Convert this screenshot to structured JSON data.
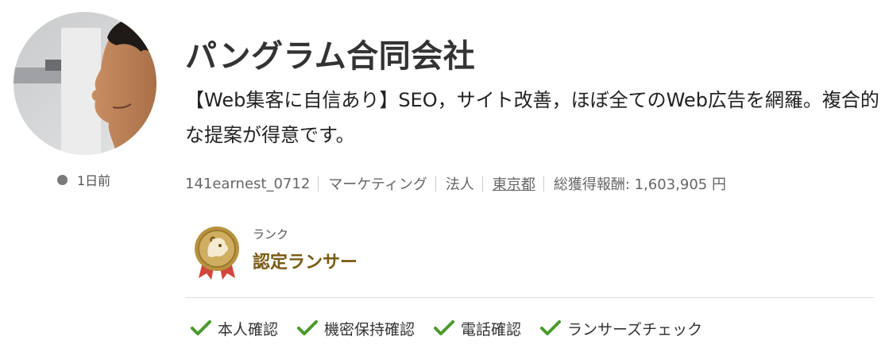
{
  "profile": {
    "name": "パングラム合同会社",
    "catchphrase": "【Web集客に自信あり】SEO，サイト改善，ほぼ全てのWeb広告を網羅。複合的な提案が得意です。",
    "status": "1日前"
  },
  "meta": {
    "username": "141earnest_0712",
    "category": "マーケティング",
    "type": "法人",
    "location": "東京都",
    "earnings": "総獲得報酬: 1,603,905 円"
  },
  "rank": {
    "label": "ランク",
    "value": "認定ランサー"
  },
  "verifications": [
    {
      "label": "本人確認"
    },
    {
      "label": "機密保持確認"
    },
    {
      "label": "電話確認"
    },
    {
      "label": "ランサーズチェック"
    }
  ],
  "colors": {
    "check": "#4a9a2c",
    "rank_text": "#7a5a12",
    "badge_gold": "#b8923e",
    "ribbon": "#d0463b"
  }
}
